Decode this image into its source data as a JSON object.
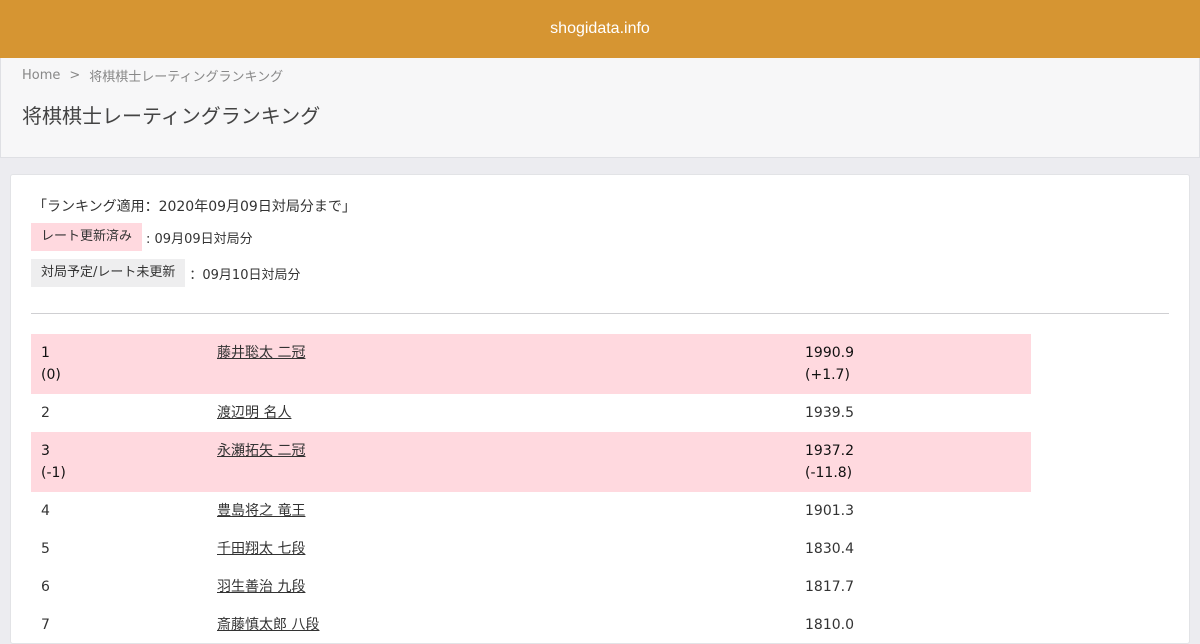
{
  "header": {
    "site_title": "shogidata.info"
  },
  "breadcrumb": {
    "home": "Home",
    "separator": ">",
    "current": "将棋棋士レーティングランキング"
  },
  "page_title": "将棋棋士レーティングランキング",
  "applied_note": "「ランキング適用：2020年09月09日対局分まで」",
  "legend": {
    "updated": {
      "tag": "レート更新済み",
      "text": ": 09月09日対局分"
    },
    "pending": {
      "tag": "対局予定/レート未更新",
      "text": "：09月10日対局分"
    }
  },
  "colors": {
    "topbar": "#d69532",
    "updated_bg": "#ffd9df",
    "pending_bg": "#eeeeef"
  },
  "rankings": [
    {
      "rank": "1",
      "change": "(0)",
      "name": "藤井聡太 二冠",
      "rating": "1990.9",
      "rating_change": "(+1.7)",
      "updated": true
    },
    {
      "rank": "2",
      "change": "",
      "name": "渡辺明 名人",
      "rating": "1939.5",
      "rating_change": "",
      "updated": false
    },
    {
      "rank": "3",
      "change": "(-1)",
      "name": "永瀬拓矢 二冠",
      "rating": "1937.2",
      "rating_change": "(-11.8)",
      "updated": true
    },
    {
      "rank": "4",
      "change": "",
      "name": "豊島将之 竜王",
      "rating": "1901.3",
      "rating_change": "",
      "updated": false
    },
    {
      "rank": "5",
      "change": "",
      "name": "千田翔太 七段",
      "rating": "1830.4",
      "rating_change": "",
      "updated": false
    },
    {
      "rank": "6",
      "change": "",
      "name": "羽生善治 九段",
      "rating": "1817.7",
      "rating_change": "",
      "updated": false
    },
    {
      "rank": "7",
      "change": "",
      "name": "斎藤慎太郎 八段",
      "rating": "1810.0",
      "rating_change": "",
      "updated": false
    }
  ]
}
